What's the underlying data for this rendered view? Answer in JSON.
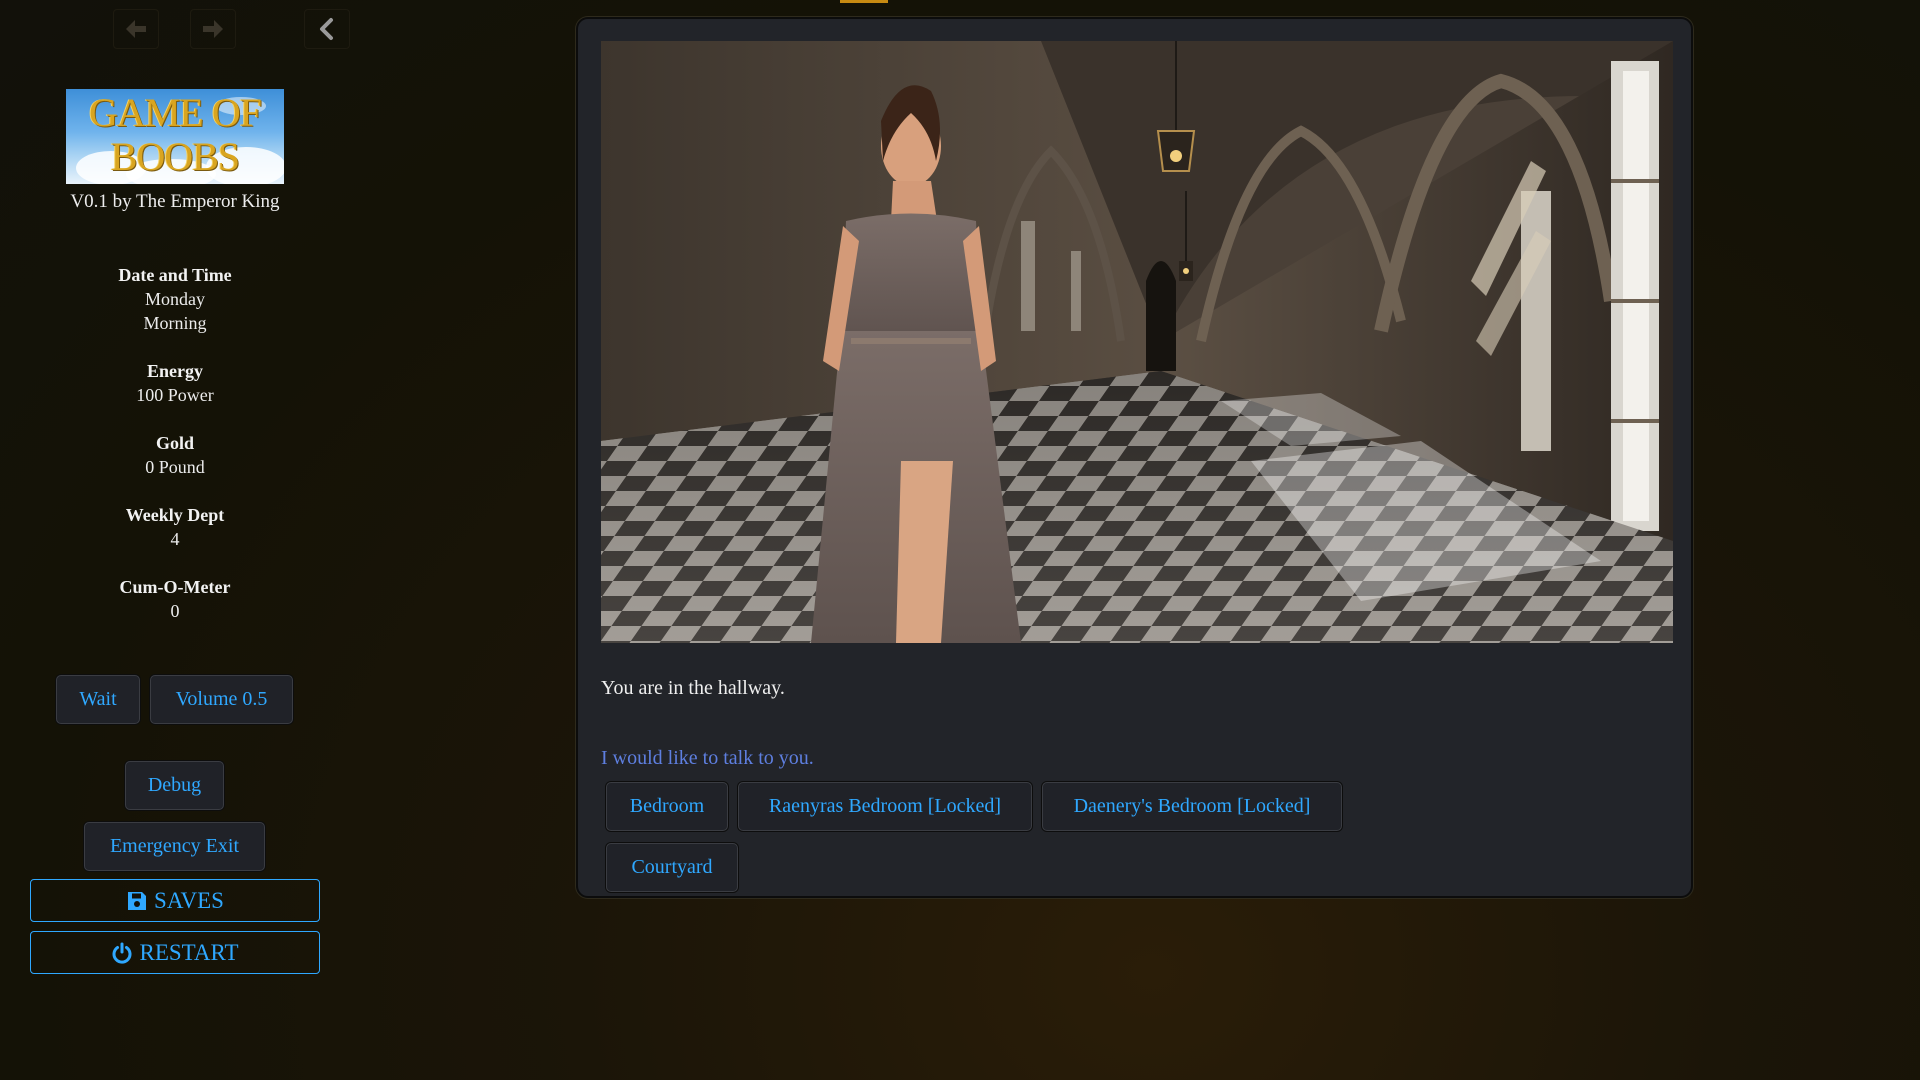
{
  "sidebar": {
    "back_icon": "arrow-left-icon",
    "forward_icon": "arrow-right-icon",
    "collapse_icon": "chevron-left-icon",
    "logo_text": "GAME OF\nBOOBS",
    "version": "V0.1 by The Emperor King",
    "stats": [
      {
        "label": "Date and Time",
        "values": [
          "Monday",
          "Morning"
        ]
      },
      {
        "label": "Energy",
        "values": [
          "100 Power"
        ]
      },
      {
        "label": "Gold",
        "values": [
          "0 Pound"
        ]
      },
      {
        "label": "Weekly Dept",
        "values": [
          "4"
        ]
      },
      {
        "label": "Cum-O-Meter",
        "values": [
          "0"
        ]
      }
    ],
    "buttons": {
      "wait": "Wait",
      "volume": "Volume 0.5",
      "debug": "Debug",
      "emergency_exit": "Emergency Exit",
      "saves": "SAVES",
      "restart": "RESTART"
    }
  },
  "passage": {
    "scene_image": "woman-in-palace-hallway",
    "text": "You are in the hallway.",
    "talk_link": "I would like to talk to you.",
    "choices": [
      {
        "label": "Bedroom"
      },
      {
        "label": "Raenyras Bedroom [Locked]"
      },
      {
        "label": "Daenery's Bedroom [Locked]"
      },
      {
        "label": "Courtyard"
      }
    ]
  },
  "colors": {
    "link": "#2fa8ff",
    "talk_link": "#5e7fe0",
    "panel": "#222429",
    "background": "#141206",
    "accent": "#c78a12"
  }
}
